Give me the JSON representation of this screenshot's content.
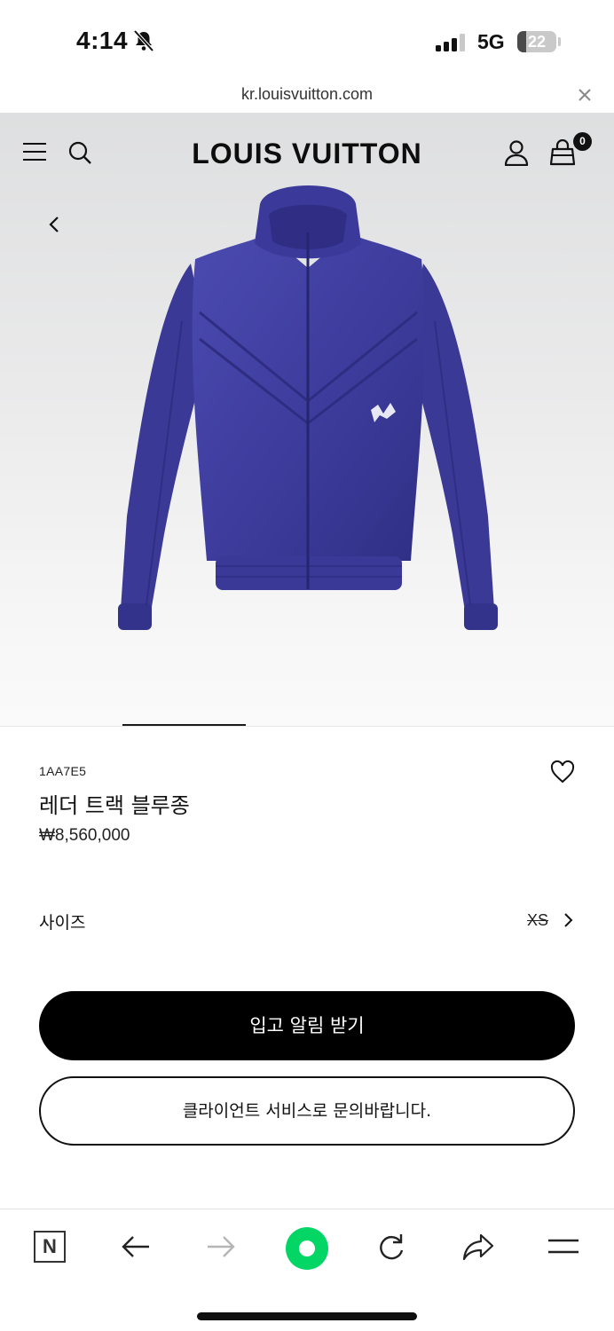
{
  "status_bar": {
    "time": "4:14",
    "network": "5G",
    "battery": "22",
    "battery_level": 0.22
  },
  "browser": {
    "url": "kr.louisvuitton.com"
  },
  "site": {
    "logo": "LOUIS VUITTON",
    "cart_count": "0"
  },
  "product": {
    "sku": "1AA7E5",
    "name": "레더 트랙 블루종",
    "price": "₩8,560,000",
    "jacket_color": "#3f3f9e"
  },
  "size_selector": {
    "label": "사이즈",
    "value": "XS"
  },
  "actions": {
    "notify_label": "입고 알림 받기",
    "contact_label": "클라이언트 서비스로 문의바랍니다."
  },
  "toolbar": {
    "naver_label": "N",
    "accent": "#03d665"
  },
  "icons": [
    "bell-slash-icon",
    "signal-icon",
    "close-icon",
    "menu-icon",
    "search-icon",
    "account-icon",
    "bag-icon",
    "chevron-left-icon",
    "heart-icon",
    "chevron-right-icon",
    "back-arrow-icon",
    "forward-arrow-icon",
    "reload-icon",
    "share-icon",
    "hamburger-icon"
  ]
}
